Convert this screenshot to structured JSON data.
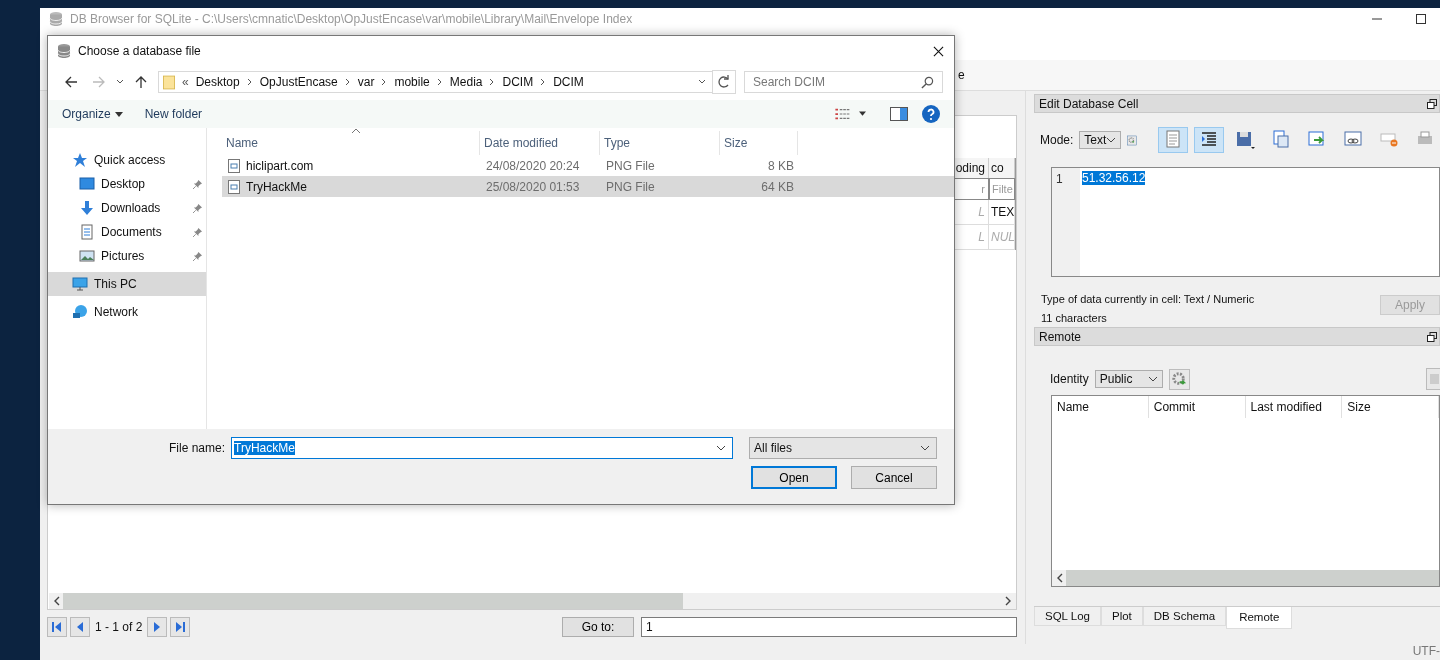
{
  "main_window": {
    "title": "DB Browser for SQLite - C:\\Users\\cmnatic\\Desktop\\OpJustEncase\\var\\mobile\\Library\\Mail\\Envelope Index",
    "toolbar_fragment": "e"
  },
  "table": {
    "columns": [
      {
        "header": "oding",
        "filter": "r"
      },
      {
        "header": "co",
        "filter": "Filte"
      }
    ],
    "rows": [
      [
        {
          "text": "L",
          "null": true
        },
        {
          "text": "TEX",
          "null": false
        }
      ],
      [
        {
          "text": "L",
          "null": true
        },
        {
          "text": "NUL",
          "null": true
        }
      ]
    ]
  },
  "pager": {
    "range": "1 - 1 of 2",
    "goto_label": "Go to:",
    "goto_value": "1"
  },
  "edit_cell": {
    "title": "Edit Database Cell",
    "mode_label": "Mode:",
    "mode": "Text",
    "tools": [
      {
        "kind": "text",
        "on": true
      },
      {
        "kind": "wrap",
        "on": true
      },
      {
        "kind": "save",
        "on": false
      },
      {
        "kind": "copy",
        "on": false
      },
      {
        "kind": "export",
        "on": false
      },
      {
        "kind": "link",
        "on": false
      },
      {
        "kind": "clear",
        "on": false
      },
      {
        "kind": "print",
        "on": false
      }
    ],
    "line_number": "1",
    "value": "51.32.56.12",
    "type_info": "Type of data currently in cell: Text / Numeric",
    "length": "11 characters",
    "apply": {
      "label": "Apply",
      "disabled": true
    }
  },
  "remote": {
    "title": "Remote",
    "identity_label": "Identity",
    "identity": "Public",
    "columns": [
      "Name",
      "Commit",
      "Last modified",
      "Size"
    ]
  },
  "dock_tabs": [
    {
      "label": "SQL Log",
      "selected": false
    },
    {
      "label": "Plot",
      "selected": false
    },
    {
      "label": "DB Schema",
      "selected": false
    },
    {
      "label": "Remote",
      "selected": true
    }
  ],
  "status_bar": {
    "encoding": "UTF-"
  },
  "dialog": {
    "title": "Choose a database file",
    "overflow": "«",
    "crumbs": [
      "Desktop",
      "OpJustEncase",
      "var",
      "mobile",
      "Media",
      "DCIM",
      "DCIM"
    ],
    "search": {
      "placeholder": "Search DCIM"
    },
    "organize": "Organize",
    "new_folder": "New folder",
    "nav": [
      {
        "label": "Quick access",
        "kind": "star",
        "selected": false,
        "children": [
          {
            "label": "Desktop",
            "kind": "desktop",
            "pinned": true,
            "selected": false
          },
          {
            "label": "Downloads",
            "kind": "download",
            "pinned": true,
            "selected": false
          },
          {
            "label": "Documents",
            "kind": "document",
            "pinned": true,
            "selected": false
          },
          {
            "label": "Pictures",
            "kind": "picture",
            "pinned": true,
            "selected": false
          }
        ]
      },
      {
        "label": "This PC",
        "kind": "pc",
        "selected": true
      },
      {
        "label": "Network",
        "kind": "network",
        "selected": false
      }
    ],
    "columns": [
      {
        "label": "Name",
        "sorted": true
      },
      {
        "label": "Date modified",
        "sorted": false
      },
      {
        "label": "Type",
        "sorted": false
      },
      {
        "label": "Size",
        "sorted": false
      }
    ],
    "files": [
      {
        "name": "hiclipart.com",
        "date": "24/08/2020 20:24",
        "type": "PNG File",
        "size": "8 KB",
        "selected": false
      },
      {
        "name": "TryHackMe",
        "date": "25/08/2020 01:53",
        "type": "PNG File",
        "size": "64 KB",
        "selected": true
      }
    ],
    "file_name_label": "File name:",
    "file_name": "TryHackMe",
    "file_type": "All files",
    "buttons": [
      {
        "label": "Open",
        "default": true
      },
      {
        "label": "Cancel",
        "default": false
      }
    ]
  }
}
